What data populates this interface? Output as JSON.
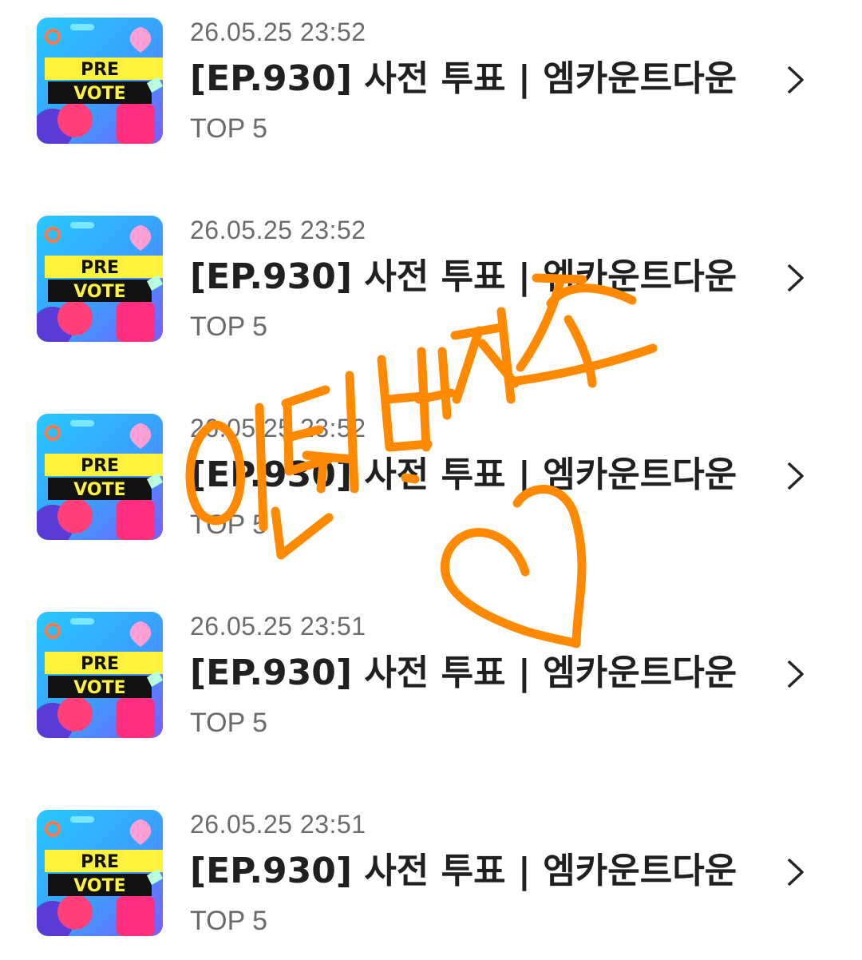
{
  "items": [
    {
      "timestamp": "26.05.25 23:52",
      "title": "[EP.930] 사전 투표 | 엠카운트다운",
      "subtitle": "TOP 5",
      "thumb_top": "PRE",
      "thumb_bottom": "VOTE"
    },
    {
      "timestamp": "26.05.25 23:52",
      "title": "[EP.930] 사전 투표 | 엠카운트다운",
      "subtitle": "TOP 5",
      "thumb_top": "PRE",
      "thumb_bottom": "VOTE"
    },
    {
      "timestamp": "26.05.25 23:52",
      "title": "[EP.930] 사전 투표 | 엠카운트다운",
      "subtitle": "TOP 5",
      "thumb_top": "PRE",
      "thumb_bottom": "VOTE"
    },
    {
      "timestamp": "26.05.25 23:51",
      "title": "[EP.930] 사전 투표 | 엠카운트다운",
      "subtitle": "TOP 5",
      "thumb_top": "PRE",
      "thumb_bottom": "VOTE"
    },
    {
      "timestamp": "26.05.25 23:51",
      "title": "[EP.930] 사전 투표 | 엠카운트다운",
      "subtitle": "TOP 5",
      "thumb_top": "PRE",
      "thumb_bottom": "VOTE"
    }
  ],
  "icons": {
    "chevron": "chevron-right-icon",
    "thumbnail": "pre-vote-thumbnail",
    "doodle": "heart-scribble"
  },
  "colors": {
    "scribble": "#ff8a00",
    "title": "#202020",
    "meta": "#6b6b6b",
    "thumb_banner": "#ffee33"
  },
  "handwriting": "인티브자즈"
}
